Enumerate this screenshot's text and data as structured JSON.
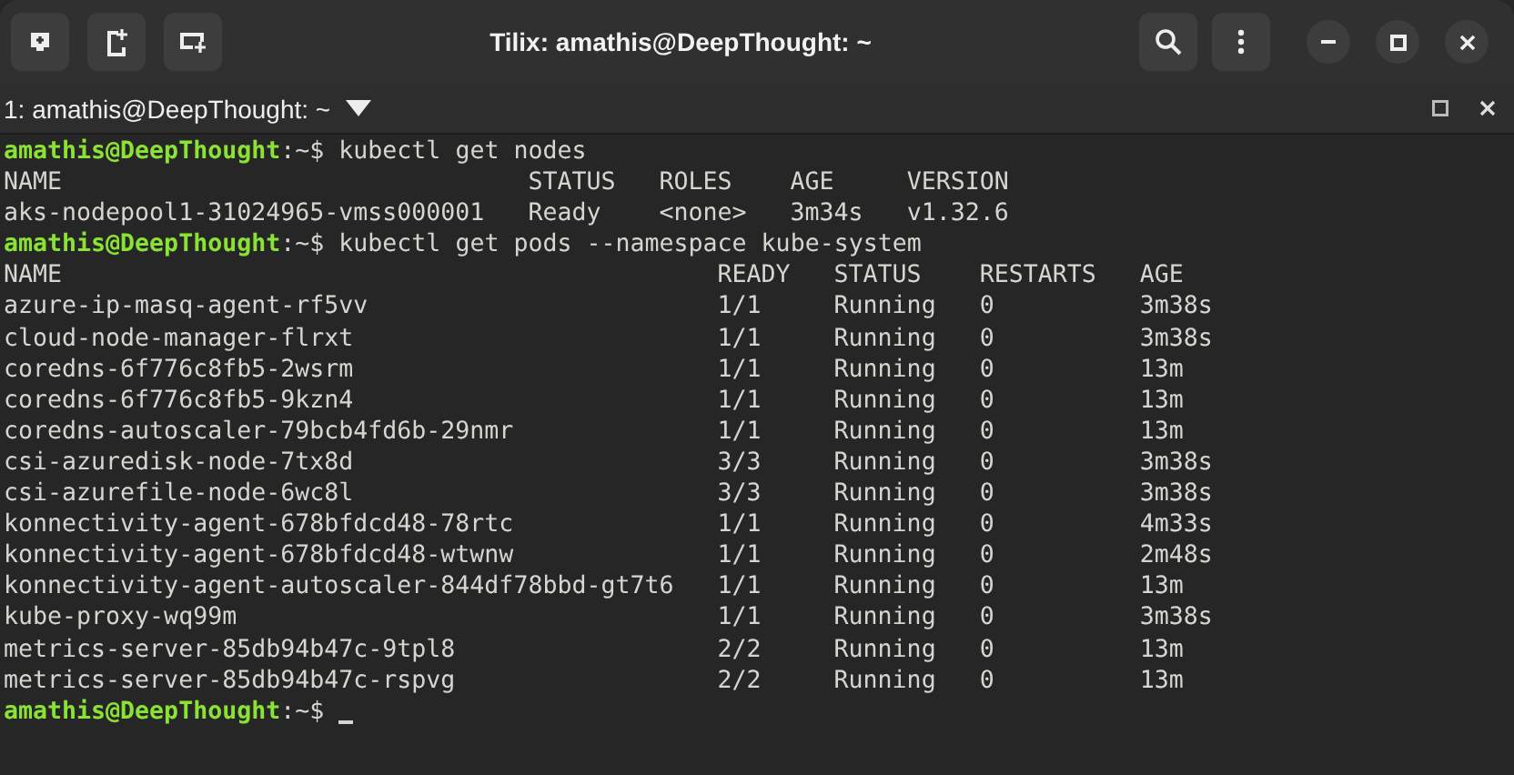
{
  "window": {
    "title": "Tilix: amathis@DeepThought: ~"
  },
  "session": {
    "title": "1: amathis@DeepThought: ~"
  },
  "terminal": [
    {
      "kind": "prompt",
      "user": "amathis@DeepThought",
      "path": ":~$",
      "command": "kubectl get nodes"
    },
    {
      "kind": "table",
      "columns": [
        "NAME",
        "STATUS",
        "ROLES",
        "AGE",
        "VERSION"
      ],
      "rows": [
        [
          "aks-nodepool1-31024965-vmss000001",
          "Ready",
          "<none>",
          "3m34s",
          "v1.32.6"
        ]
      ]
    },
    {
      "kind": "prompt",
      "user": "amathis@DeepThought",
      "path": ":~$",
      "command": "kubectl get pods --namespace kube-system"
    },
    {
      "kind": "table",
      "columns": [
        "NAME",
        "READY",
        "STATUS",
        "RESTARTS",
        "AGE"
      ],
      "rows": [
        [
          "azure-ip-masq-agent-rf5vv",
          "1/1",
          "Running",
          "0",
          "3m38s"
        ],
        [
          "cloud-node-manager-flrxt",
          "1/1",
          "Running",
          "0",
          "3m38s"
        ],
        [
          "coredns-6f776c8fb5-2wsrm",
          "1/1",
          "Running",
          "0",
          "13m"
        ],
        [
          "coredns-6f776c8fb5-9kzn4",
          "1/1",
          "Running",
          "0",
          "13m"
        ],
        [
          "coredns-autoscaler-79bcb4fd6b-29nmr",
          "1/1",
          "Running",
          "0",
          "13m"
        ],
        [
          "csi-azuredisk-node-7tx8d",
          "3/3",
          "Running",
          "0",
          "3m38s"
        ],
        [
          "csi-azurefile-node-6wc8l",
          "3/3",
          "Running",
          "0",
          "3m38s"
        ],
        [
          "konnectivity-agent-678bfdcd48-78rtc",
          "1/1",
          "Running",
          "0",
          "4m33s"
        ],
        [
          "konnectivity-agent-678bfdcd48-wtwnw",
          "1/1",
          "Running",
          "0",
          "2m48s"
        ],
        [
          "konnectivity-agent-autoscaler-844df78bbd-gt7t6",
          "1/1",
          "Running",
          "0",
          "13m"
        ],
        [
          "kube-proxy-wq99m",
          "1/1",
          "Running",
          "0",
          "3m38s"
        ],
        [
          "metrics-server-85db94b47c-9tpl8",
          "2/2",
          "Running",
          "0",
          "13m"
        ],
        [
          "metrics-server-85db94b47c-rspvg",
          "2/2",
          "Running",
          "0",
          "13m"
        ]
      ]
    },
    {
      "kind": "prompt",
      "user": "amathis@DeepThought",
      "path": ":~$",
      "cursor": true
    }
  ]
}
